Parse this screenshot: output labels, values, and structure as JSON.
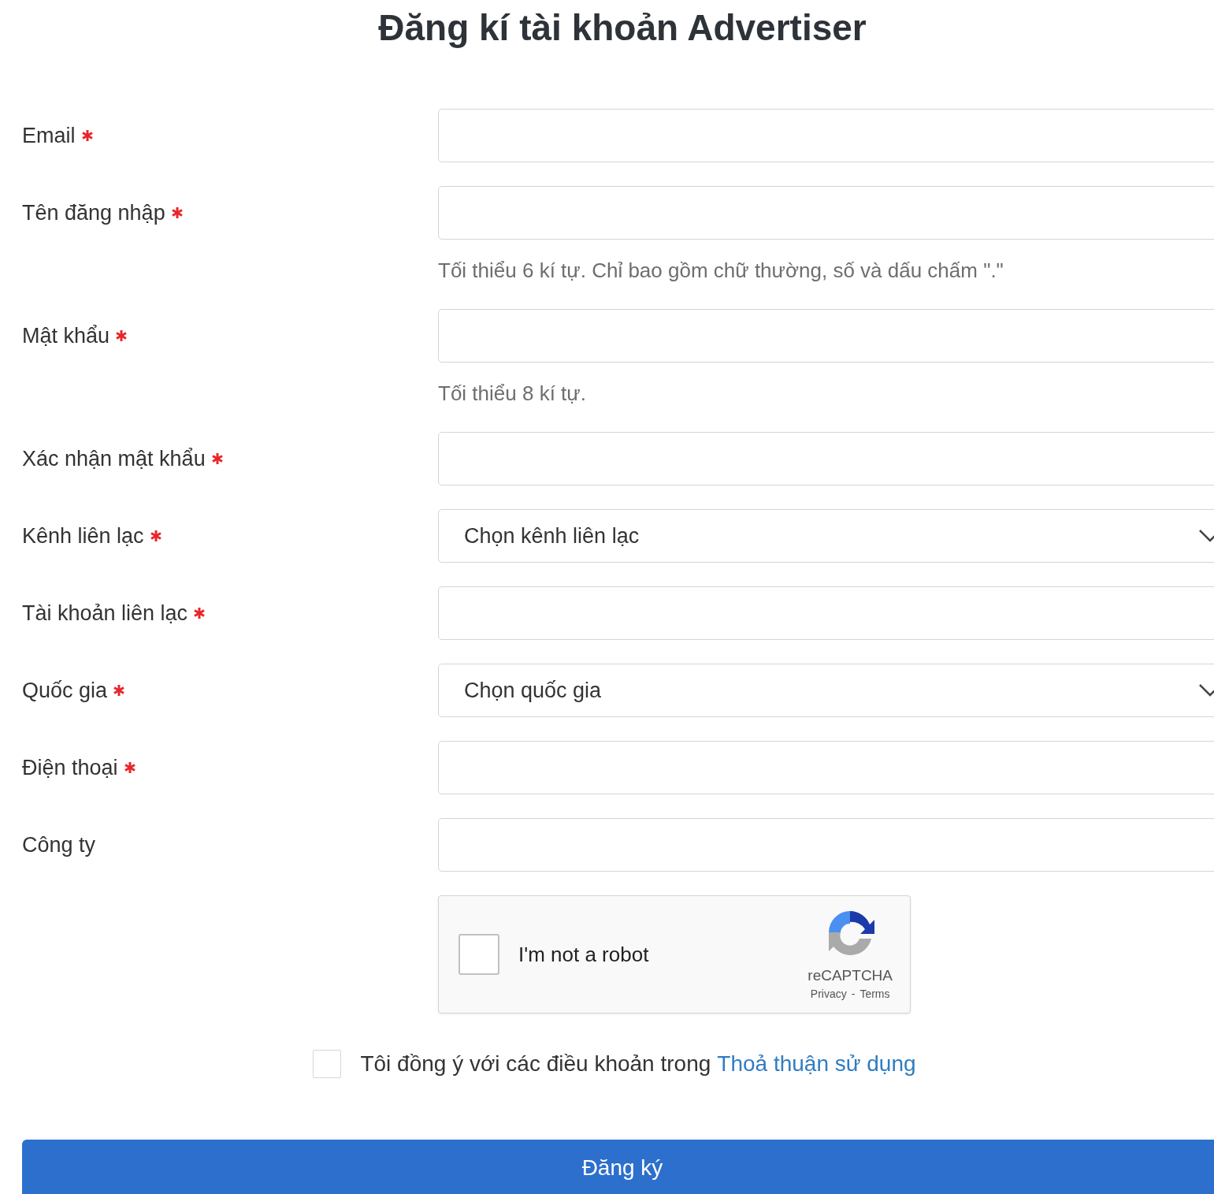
{
  "title": "Đăng kí tài khoản Advertiser",
  "fields": [
    {
      "kind": "text",
      "label": "Email",
      "required": true
    },
    {
      "kind": "text",
      "label": "Tên đăng nhập",
      "required": true,
      "hint": "Tối thiểu 6 kí tự. Chỉ bao gồm chữ thường, số và dấu chấm \".\""
    },
    {
      "kind": "text",
      "label": "Mật khẩu",
      "required": true,
      "hint": "Tối thiểu 8 kí tự."
    },
    {
      "kind": "text",
      "label": "Xác nhận mật khẩu",
      "required": true
    },
    {
      "kind": "select",
      "label": "Kênh liên lạc",
      "required": true,
      "placeholder": "Chọn kênh liên lạc"
    },
    {
      "kind": "text",
      "label": "Tài khoản liên lạc",
      "required": true
    },
    {
      "kind": "select",
      "label": "Quốc gia",
      "required": true,
      "placeholder": "Chọn quốc gia"
    },
    {
      "kind": "text",
      "label": "Điện thoại",
      "required": true
    },
    {
      "kind": "text",
      "label": "Công ty",
      "required": false
    }
  ],
  "captcha": {
    "checked": false,
    "label": "I'm not a robot",
    "brand": "reCAPTCHA",
    "privacy": "Privacy",
    "separator": "-",
    "terms": "Terms"
  },
  "agreement": {
    "checked": false,
    "text": "Tôi đồng ý với các điều khoản trong",
    "link": "Thoả thuận sử dụng"
  },
  "submit": "Đăng ký"
}
